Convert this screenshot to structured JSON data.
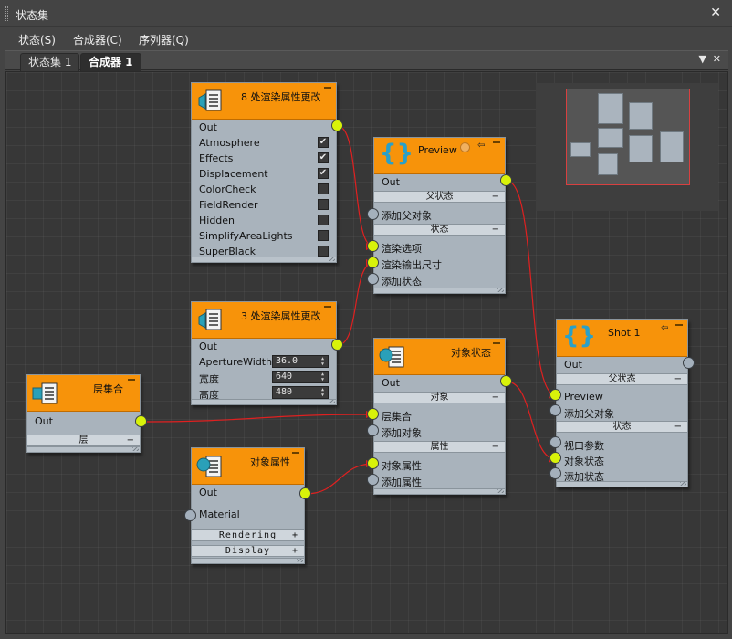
{
  "window": {
    "title": "状态集"
  },
  "menu": [
    "状态(S)",
    "合成器(C)",
    "序列器(Q)"
  ],
  "tabs": [
    "状态集 1",
    "合成器 1"
  ],
  "nodes": {
    "render8": {
      "title": "8 处渲染属性更改",
      "out": "Out",
      "props": [
        {
          "label": "Atmosphere",
          "checked": true
        },
        {
          "label": "Effects",
          "checked": true
        },
        {
          "label": "Displacement",
          "checked": true
        },
        {
          "label": "ColorCheck",
          "checked": false
        },
        {
          "label": "FieldRender",
          "checked": false
        },
        {
          "label": "Hidden",
          "checked": false
        },
        {
          "label": "SimplifyAreaLights",
          "checked": false
        },
        {
          "label": "SuperBlack",
          "checked": false
        }
      ]
    },
    "render3": {
      "title": "3 处渲染属性更改",
      "out": "Out",
      "rows": [
        {
          "label": "ApertureWidth",
          "value": "36.0"
        },
        {
          "label": "宽度",
          "value": "640"
        },
        {
          "label": "高度",
          "value": "480"
        }
      ]
    },
    "preview": {
      "title": "Preview",
      "out": "Out",
      "parent_section": "父状态",
      "add_parent": "添加父对象",
      "state_section": "状态",
      "inputs": [
        "渲染选项",
        "渲染输出尺寸",
        "添加状态"
      ]
    },
    "layer": {
      "title": "层集合",
      "out": "Out",
      "section": "层"
    },
    "objstate": {
      "title": "对象状态",
      "out": "Out",
      "obj_section": "对象",
      "obj_inputs": [
        "层集合",
        "添加对象"
      ],
      "attr_section": "属性",
      "attr_inputs": [
        "对象属性",
        "添加属性"
      ]
    },
    "objattr": {
      "title": "对象属性",
      "out": "Out",
      "material": "Material",
      "sections": [
        "Rendering",
        "Display"
      ]
    },
    "shot1": {
      "title": "Shot 1",
      "out": "Out",
      "parent_section": "父状态",
      "parent_inputs": [
        "Preview",
        "添加父对象"
      ],
      "state_section": "状态",
      "state_inputs": [
        "视口参数",
        "对象状态",
        "添加状态"
      ]
    }
  },
  "colors": {
    "node_header": "#f7930a",
    "node_body": "#a9b3bc",
    "socket_active": "#d8f20a",
    "socket_idle": "#a4b0bc",
    "wire": "#e02020"
  }
}
